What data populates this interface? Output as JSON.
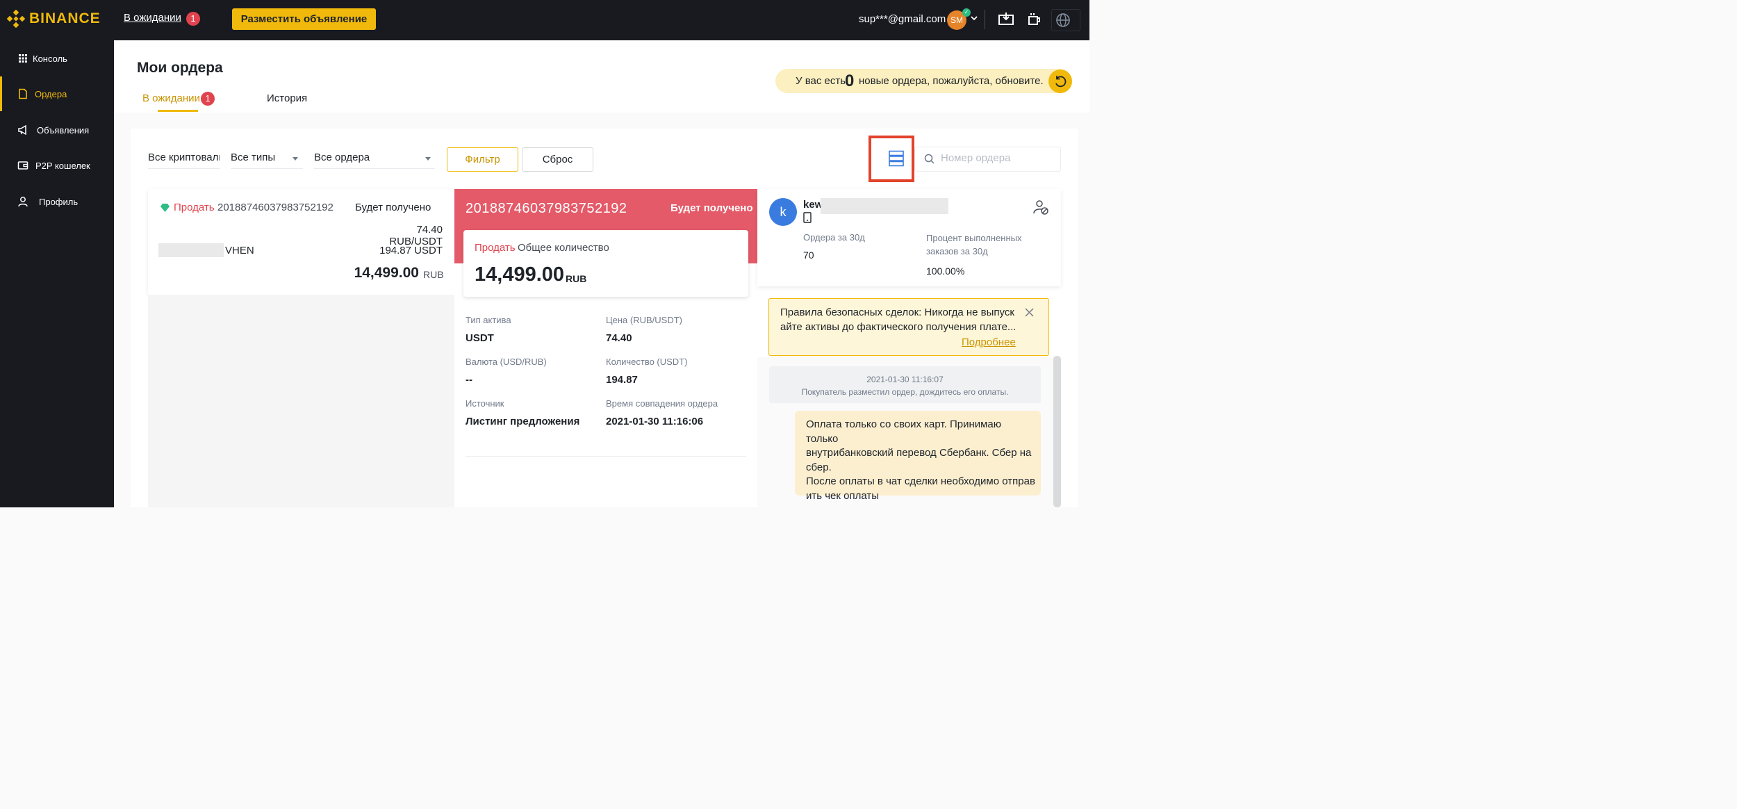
{
  "brand": {
    "name": "BINANCE",
    "color": "#f0b90b"
  },
  "topbar": {
    "pending_label": "В ожидании",
    "pending_count": "1",
    "post_ad_label": "Разместить объявление",
    "user_email": "sup***@gmail.com",
    "avatar_initials": "SM",
    "icons": [
      "download-icon",
      "coffee-icon",
      "globe-icon"
    ]
  },
  "sidebar": {
    "items": [
      {
        "label": "Консоль",
        "icon": "grid-icon"
      },
      {
        "label": "Ордера",
        "icon": "document-icon",
        "active": true
      },
      {
        "label": "Объявления",
        "icon": "megaphone-icon"
      },
      {
        "label": "P2P кошелек",
        "icon": "wallet-icon"
      },
      {
        "label": "Профиль",
        "icon": "user-icon"
      }
    ]
  },
  "page": {
    "title": "Мои ордера",
    "tabs": [
      {
        "label": "В ожидании",
        "count": "1",
        "active": true
      },
      {
        "label": "История"
      }
    ],
    "refresh_notice": {
      "prefix": "У вас есть",
      "count": "0",
      "suffix": "новые ордера, пожалуйста, обновите."
    }
  },
  "filters": {
    "crypto_select": "Все криптовалюты",
    "type_select": "Все типы",
    "order_select": "Все ордера",
    "filter_label": "Фильтр",
    "reset_label": "Сброс",
    "search_placeholder": "Номер ордера"
  },
  "order_card": {
    "side": "Продать",
    "order_number": "20188746037983752192",
    "receive_label": "Будет получено",
    "price": "74.40 RUB/USDT",
    "counterparty_suffix": "VHEN",
    "quantity": "194.87 USDT",
    "amount": "14,499.00",
    "amount_currency": "RUB"
  },
  "order_detail": {
    "order_number": "20188746037983752192",
    "receive_label": "Будет получено",
    "side": "Продать",
    "total_label": "Общее количество",
    "total": "14,499.00",
    "total_currency": "RUB",
    "fields": [
      {
        "label": "Тип актива",
        "value": "USDT"
      },
      {
        "label": "Цена (RUB/USDT)",
        "value": "74.40"
      },
      {
        "label": "Валюта (USD/RUB)",
        "value": "--"
      },
      {
        "label": "Количество (USDT)",
        "value": "194.87"
      },
      {
        "label": "Источник",
        "value": "Листинг предложения"
      },
      {
        "label": "Время совпадения ордера",
        "value": "2021-01-30 11:16:06"
      }
    ]
  },
  "counterparty": {
    "avatar_letter": "k",
    "name_prefix": "kew",
    "orders_30d_label": "Ордера за 30д",
    "orders_30d": "70",
    "completion_label_line1": "Процент выполненных",
    "completion_label_line2": "заказов за 30д",
    "completion_rate": "100.00%"
  },
  "safety_notice": {
    "line1": "Правила безопасных сделок: Никогда не выпуск",
    "line2": "айте активы до фактического получения плате...",
    "more_label": "Подробнее"
  },
  "chat": {
    "system_time": "2021-01-30 11:16:07",
    "system_text": "Покупатель разместил ордер, дождитесь его оплаты.",
    "message_lines": [
      "Оплата только со своих карт. Принимаю только",
      "внутрибанковский перевод Сбербанк. Сбер на",
      "сбер.",
      "После оплаты в чат сделки необходимо отправ",
      "ить чек оплаты"
    ]
  }
}
